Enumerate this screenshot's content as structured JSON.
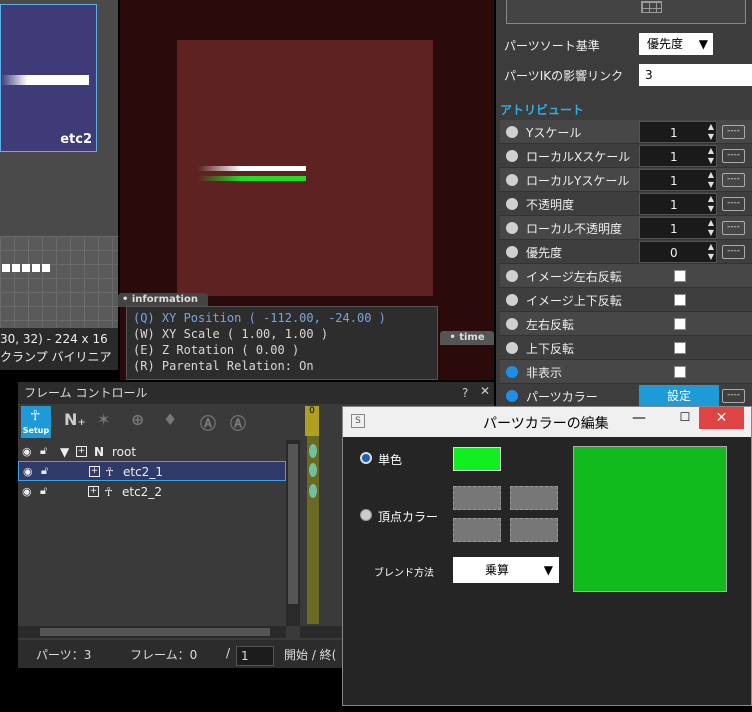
{
  "image_panel": {
    "preview_label": "etc2",
    "info_line1": "30, 32) - 224 x 16",
    "info_line2": "クランプ バイリニア"
  },
  "information": {
    "tab": "information",
    "lines": [
      "(Q) XY Position ( -112.00, -24.00 )",
      "(W) XY Scale ( 1.00, 1.00 )",
      "(E) Z Rotation ( 0.00 )",
      "(R) Parental Relation: On"
    ]
  },
  "time_tab": "time",
  "right_panel": {
    "sort_label": "パーツソート基準",
    "sort_value": "優先度",
    "ik_label": "パーツIKの影響リンク",
    "ik_value": "3",
    "attr_header": "アトリビュート",
    "rows": [
      {
        "name": "Yスケール",
        "value": "1"
      },
      {
        "name": "ローカルXスケール",
        "value": "1"
      },
      {
        "name": "ローカルYスケール",
        "value": "1"
      },
      {
        "name": "不透明度",
        "value": "1"
      },
      {
        "name": "ローカル不透明度",
        "value": "1"
      },
      {
        "name": "優先度",
        "value": "0"
      },
      {
        "name": "イメージ左右反転"
      },
      {
        "name": "イメージ上下反転"
      },
      {
        "name": "左右反転"
      },
      {
        "name": "上下反転"
      },
      {
        "name": "非表示"
      },
      {
        "name": "パーツカラー",
        "button": "設定"
      }
    ],
    "dash_label": "----"
  },
  "frame_control": {
    "title": "フレーム コントロール",
    "help": "?",
    "close": "✕",
    "setup_label": "Setup",
    "tree": [
      {
        "name": "root"
      },
      {
        "name": "etc2_1"
      },
      {
        "name": "etc2_2"
      }
    ],
    "timeline_frame": "0",
    "status_parts_label": "パーツ：3",
    "status_frame_label": "フレーム：0",
    "status_slash": "/",
    "status_total": "1",
    "status_start": "開始 / 終("
  },
  "dialog": {
    "title": "パーツカラーの編集",
    "single_label": "単色",
    "vertex_label": "頂点カラー",
    "blend_label": "ブレンド方法",
    "blend_value": "乗算",
    "single_color": "#11ee22",
    "preview_color": "#11bb1e"
  }
}
